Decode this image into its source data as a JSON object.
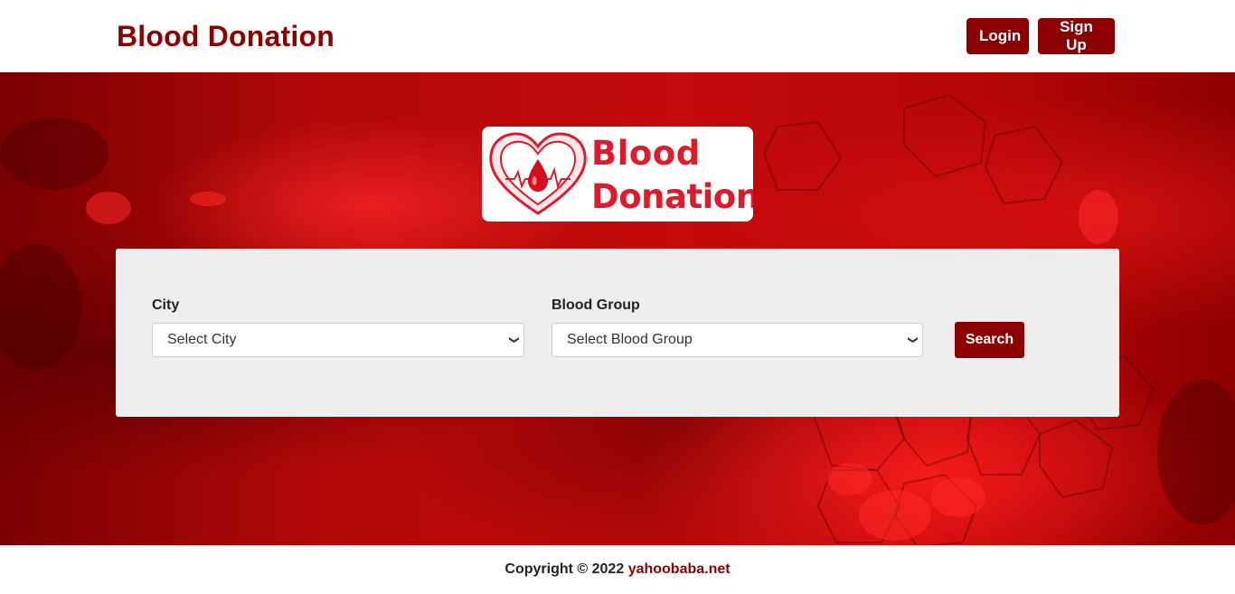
{
  "header": {
    "brand": "Blood Donation",
    "login_label": "Login",
    "signup_label": "Sign Up"
  },
  "hero": {
    "logo": {
      "line1": "Blood",
      "line2": "Donation",
      "icon": "heart-blood-drop-icon"
    }
  },
  "search_form": {
    "city_label": "City",
    "city_selected": "Select City",
    "blood_group_label": "Blood Group",
    "blood_group_selected": "Select Blood Group",
    "search_label": "Search"
  },
  "footer": {
    "copyright": "Copyright © 2022",
    "link_text": "yahoobaba.net"
  },
  "colors": {
    "brand": "#8b0000",
    "logo_red": "#e01a2a",
    "panel": "#eeeeee"
  }
}
